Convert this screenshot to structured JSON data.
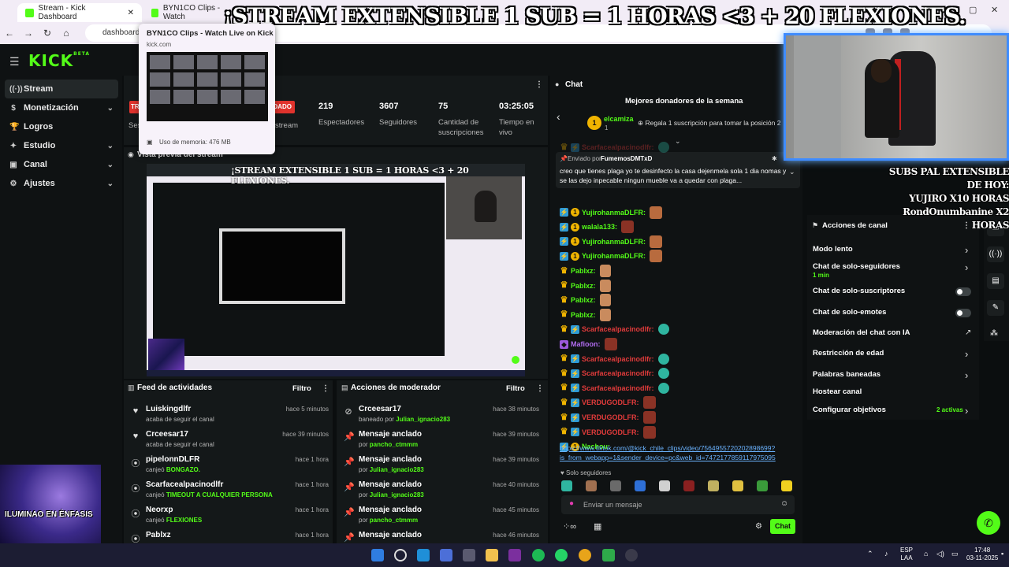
{
  "browser": {
    "tab1_title": "Stream - Kick Dashboard",
    "tab2_title": "BYN1CO Clips - Watch",
    "url": "dashboard.k",
    "tooltip": {
      "title": "BYN1CO Clips - Watch Live on Kick",
      "domain": "kick.com",
      "memory": "Uso de memoria: 476 MB"
    }
  },
  "stream_title": "¡STREAM EXTENSIBLE 1 SUB = 1 HORAS <3 + 20 FLEXIONES.",
  "logo": "KICK",
  "logo_tag": "BETA",
  "sidebar": {
    "items": [
      {
        "label": "Stream",
        "icon": "broadcast-icon"
      },
      {
        "label": "Monetización",
        "icon": "dollar-icon"
      },
      {
        "label": "Logros",
        "icon": "trophy-icon"
      },
      {
        "label": "Estudio",
        "icon": "studio-icon"
      },
      {
        "label": "Canal",
        "icon": "channel-icon"
      },
      {
        "label": "Ajustes",
        "icon": "gear-icon"
      }
    ]
  },
  "session": {
    "badge_left": "TR",
    "badge_right": "DADO",
    "sess_label": "Ses",
    "stream_label": "stream",
    "stats": [
      {
        "value": "219",
        "label": "Espectadores"
      },
      {
        "value": "3607",
        "label": "Seguidores"
      },
      {
        "value": "75",
        "label": "Cantidad de suscripciones"
      },
      {
        "value": "03:25:05",
        "label": "Tiempo en vivo"
      }
    ]
  },
  "preview": {
    "header": "Vista previa del stream",
    "overlay": "¡STREAM EXTENSIBLE 1 SUB = 1 HORAS <3 + 20 FLEXIONES."
  },
  "activity": {
    "title": "Feed de actividades",
    "filter": "Filtro",
    "rows": [
      {
        "icon": "heart-icon",
        "name": "Luiskingdlfr",
        "sub": "acaba de seguir el canal",
        "green": "",
        "time": "hace 5 minutos"
      },
      {
        "icon": "heart-icon",
        "name": "Crceesar17",
        "sub": "acaba de seguir el canal",
        "green": "",
        "time": "hace 39 minutos"
      },
      {
        "icon": "points-icon",
        "name": "pipelonnDLFR",
        "sub": "canjeó",
        "green": "BONGAZO.",
        "time": "hace 1 hora"
      },
      {
        "icon": "points-icon",
        "name": "Scarfacealpacinodlfr",
        "sub": "canjeó",
        "green": "TIMEOUT A CUALQUIER PERSONA",
        "time": "hace 1 hora"
      },
      {
        "icon": "points-icon",
        "name": "Neorxp",
        "sub": "canjeó",
        "green": "FLEXIONES",
        "time": "hace 1 hora"
      },
      {
        "icon": "points-icon",
        "name": "Pablxz",
        "sub": "",
        "green": "",
        "time": "hace 1 hora"
      }
    ]
  },
  "modactions": {
    "title": "Acciones de moderador",
    "filter": "Filtro",
    "rows": [
      {
        "icon": "ban-icon",
        "name": "Crceesar17",
        "sub": "baneado por",
        "green": "Julian_ignacio283",
        "time": "hace 38 minutos"
      },
      {
        "icon": "pin-icon",
        "name": "Mensaje anclado",
        "sub": "por",
        "green": "pancho_ctmmm",
        "time": "hace 39 minutos"
      },
      {
        "icon": "pin-icon",
        "name": "Mensaje anclado",
        "sub": "por",
        "green": "Julian_ignacio283",
        "time": "hace 39 minutos"
      },
      {
        "icon": "pin-icon",
        "name": "Mensaje anclado",
        "sub": "por",
        "green": "Julian_ignacio283",
        "time": "hace 40 minutos"
      },
      {
        "icon": "pin-icon",
        "name": "Mensaje anclado",
        "sub": "por",
        "green": "pancho_ctmmm",
        "time": "hace 45 minutos"
      },
      {
        "icon": "pin-icon",
        "name": "Mensaje anclado",
        "sub": "",
        "green": "",
        "time": "hace 46 minutos"
      }
    ]
  },
  "chat": {
    "title": "Chat",
    "top_donors_title": "Mejores donadores de la semana",
    "top_donor_rank": "1",
    "top_donor_name": "elcamiza",
    "top_donor_count": "1",
    "gift_hint": "Regala 1 suscripción para tomar la posición 2",
    "pinned_by_prefix": "Enviado por",
    "pinned_by": "FumemosDMTxD",
    "pinned_text": "creo que tienes plaga yo te desinfecto la casa dejenmela sola 1 dia nomas y se las dejo inpecable ningun mueble va a quedar con plaga...",
    "messages": [
      {
        "name": "Scarfacealpacinodlfr:",
        "color": "#e23b3b",
        "badges": [
          "crown",
          "blue"
        ],
        "emote": "teal"
      },
      {
        "name": "YujirohanmaDLFR:",
        "color": "#53fc18",
        "badges": [
          "blue",
          "gold"
        ],
        "emote": "pepe"
      },
      {
        "name": "walala133:",
        "color": "#53fc18",
        "badges": [
          "blue",
          "gold"
        ],
        "emote": "red"
      },
      {
        "name": "YujirohanmaDLFR:",
        "color": "#53fc18",
        "badges": [
          "blue",
          "gold"
        ],
        "emote": "pepe"
      },
      {
        "name": "YujirohanmaDLFR:",
        "color": "#53fc18",
        "badges": [
          "blue",
          "gold"
        ],
        "emote": "pepe"
      },
      {
        "name": "Pablxz:",
        "color": "#53fc18",
        "badges": [
          "crown"
        ],
        "emote": "dance"
      },
      {
        "name": "Pablxz:",
        "color": "#53fc18",
        "badges": [
          "crown"
        ],
        "emote": "dance"
      },
      {
        "name": "Pablxz:",
        "color": "#53fc18",
        "badges": [
          "crown"
        ],
        "emote": "dance"
      },
      {
        "name": "Pablxz:",
        "color": "#53fc18",
        "badges": [
          "crown"
        ],
        "emote": "dance"
      },
      {
        "name": "Scarfacealpacinodlfr:",
        "color": "#e23b3b",
        "badges": [
          "crown",
          "blue"
        ],
        "emote": "teal"
      },
      {
        "name": "Mafioon:",
        "color": "#b16cf0",
        "badges": [
          "purple"
        ],
        "emote": "red"
      },
      {
        "name": "Scarfacealpacinodlfr:",
        "color": "#e23b3b",
        "badges": [
          "crown",
          "blue"
        ],
        "emote": "teal"
      },
      {
        "name": "Scarfacealpacinodlfr:",
        "color": "#e23b3b",
        "badges": [
          "crown",
          "blue"
        ],
        "emote": "teal"
      },
      {
        "name": "Scarfacealpacinodlfr:",
        "color": "#e23b3b",
        "badges": [
          "crown",
          "blue"
        ],
        "emote": "teal"
      },
      {
        "name": "VERDUGODLFR:",
        "color": "#e23b3b",
        "badges": [
          "crown",
          "blue"
        ],
        "emote": "red"
      },
      {
        "name": "VERDUGODLFR:",
        "color": "#e23b3b",
        "badges": [
          "crown",
          "blue"
        ],
        "emote": "red"
      },
      {
        "name": "VERDUGODLFR:",
        "color": "#e23b3b",
        "badges": [
          "crown",
          "blue"
        ],
        "emote": "red"
      },
      {
        "name": "Nachou:",
        "color": "#53fc18",
        "badges": [
          "blue",
          "gold"
        ],
        "emote": ""
      }
    ],
    "link": "https://www.tiktok.com/@kick_chile_clips/video/7564955720202898699?is_from_webapp=1&sender_device=pc&web_id=7472177859117975095",
    "followers_only": "Solo seguidores",
    "input_placeholder": "Enviar un mensaje",
    "send": "Chat"
  },
  "webcam_subs": [
    "SUBS PAL EXTENSIBLE DE HOY:",
    "YUJIRO X10 HORAS",
    "RondOnumbanine X2 HORAS"
  ],
  "channel_actions": {
    "title": "Acciones de canal",
    "rows": [
      {
        "label": "Modo lento",
        "sub": "",
        "control": "chevron"
      },
      {
        "label": "Chat de solo-seguidores",
        "sub": "1 min",
        "control": "chevron"
      },
      {
        "label": "Chat de solo-suscriptores",
        "sub": "",
        "control": "toggle"
      },
      {
        "label": "Chat de solo-emotes",
        "sub": "",
        "control": "toggle"
      },
      {
        "label": "Moderación del chat con IA",
        "sub": "",
        "control": "external"
      },
      {
        "label": "Restricción de edad",
        "sub": "",
        "control": "chevron"
      },
      {
        "label": "Palabras baneadas",
        "sub": "",
        "control": "chevron"
      },
      {
        "label": "Hostear canal",
        "sub": "",
        "control": ""
      },
      {
        "label": "Configurar objetivos",
        "sub": "2 activas",
        "control": "chevron"
      }
    ]
  },
  "overlay_anime": "ILUMINAO EN ÉNFASIS",
  "taskbar": {
    "lang1": "ESP",
    "lang2": "LAA",
    "time": "17:48",
    "date": "03-11-2025"
  },
  "colors": {
    "accent": "#53fc18",
    "bg": "#0b0e0f",
    "panel": "#141819"
  }
}
